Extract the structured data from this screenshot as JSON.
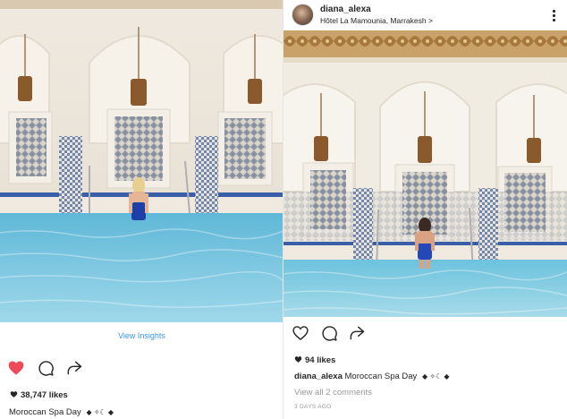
{
  "left_post": {
    "insights_label": "View Insights",
    "icons": [
      "heart-filled-icon",
      "comment-icon",
      "share-icon"
    ],
    "likes": "38,747 likes",
    "caption_user": "",
    "caption_text": "Moroccan Spa Day",
    "emoji_text": "◆ ✧☾ ◆",
    "liked": true,
    "colors": {
      "heart": "#ed4956",
      "link": "#3897f0"
    }
  },
  "right_post": {
    "username": "diana_alexa",
    "location": "Hôtel La Mamounia, Marrakesh >",
    "icons": [
      "heart-outline-icon",
      "comment-icon",
      "share-icon",
      "more-icon"
    ],
    "likes": "94 likes",
    "caption_user": "diana_alexa",
    "caption_text": "Moroccan Spa Day",
    "emoji_text": "◆ ✧☾ ◆",
    "comments_link": "View all 2 comments",
    "timestamp": "3 DAYS AGO",
    "liked": false,
    "colors": {
      "muted": "#999999",
      "text": "#262626"
    }
  }
}
